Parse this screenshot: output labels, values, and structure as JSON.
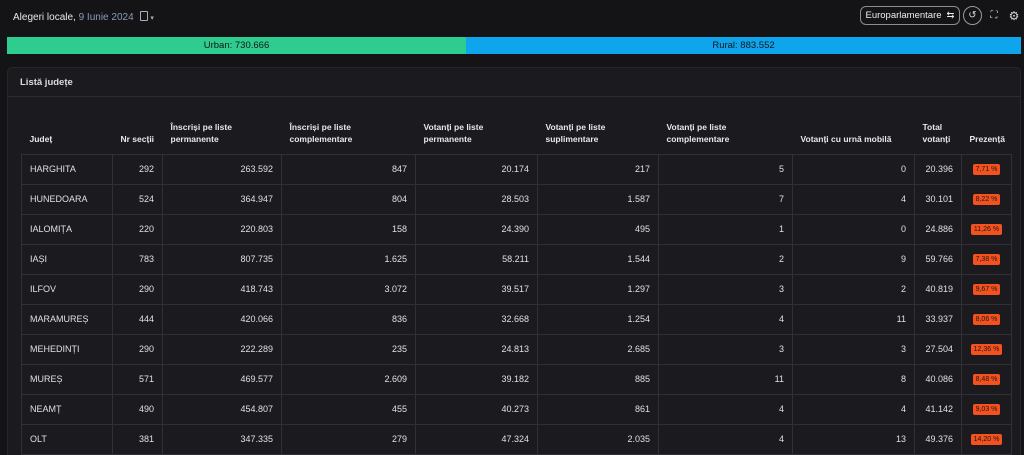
{
  "header": {
    "title": "Alegeri locale,",
    "date": "9 Iunie 2024",
    "mode_label": "Europarlamentare",
    "icons": {
      "mode_switch": "swap-arrows-icon",
      "reload": "history-icon",
      "fullscreen": "fullscreen-icon",
      "settings": "gear-icon",
      "calendar": "calendar-icon"
    }
  },
  "split": {
    "urban_label": "Urban: 730.666",
    "rural_label": "Rural: 883.552",
    "urban_value": 730666,
    "rural_value": 883552,
    "urban_color": "#2ecc8f",
    "rural_color": "#0ea5ec"
  },
  "panel": {
    "title": "Listă județe"
  },
  "table": {
    "headers": [
      "Județ",
      "Nr secții",
      "Înscriși pe liste permanente",
      "Înscriși pe liste complementare",
      "Votanți pe liste permanente",
      "Votanți pe liste suplimentare",
      "Votanți pe liste complementare",
      "Votanți cu urnă mobilă",
      "Total votanți",
      "Prezență"
    ],
    "rows": [
      [
        "HARGHITA",
        "292",
        "263.592",
        "847",
        "20.174",
        "217",
        "5",
        "0",
        "20.396",
        "7,71 %"
      ],
      [
        "HUNEDOARA",
        "524",
        "364.947",
        "804",
        "28.503",
        "1.587",
        "7",
        "4",
        "30.101",
        "8,22 %"
      ],
      [
        "IALOMIȚA",
        "220",
        "220.803",
        "158",
        "24.390",
        "495",
        "1",
        "0",
        "24.886",
        "11,26 %"
      ],
      [
        "IAȘI",
        "783",
        "807.735",
        "1.625",
        "58.211",
        "1.544",
        "2",
        "9",
        "59.766",
        "7,38 %"
      ],
      [
        "ILFOV",
        "290",
        "418.743",
        "3.072",
        "39.517",
        "1.297",
        "3",
        "2",
        "40.819",
        "9,67 %"
      ],
      [
        "MARAMUREȘ",
        "444",
        "420.066",
        "836",
        "32.668",
        "1.254",
        "4",
        "11",
        "33.937",
        "8,06 %"
      ],
      [
        "MEHEDINȚI",
        "290",
        "222.289",
        "235",
        "24.813",
        "2.685",
        "3",
        "3",
        "27.504",
        "12,36 %"
      ],
      [
        "MUREȘ",
        "571",
        "469.577",
        "2.609",
        "39.182",
        "885",
        "11",
        "8",
        "40.086",
        "8,48 %"
      ],
      [
        "NEAMȚ",
        "490",
        "454.807",
        "455",
        "40.273",
        "861",
        "4",
        "4",
        "41.142",
        "9,03 %"
      ],
      [
        "OLT",
        "381",
        "347.335",
        "279",
        "47.324",
        "2.035",
        "4",
        "13",
        "49.376",
        "14,20 %"
      ]
    ],
    "badge_color": "#f4511e"
  }
}
